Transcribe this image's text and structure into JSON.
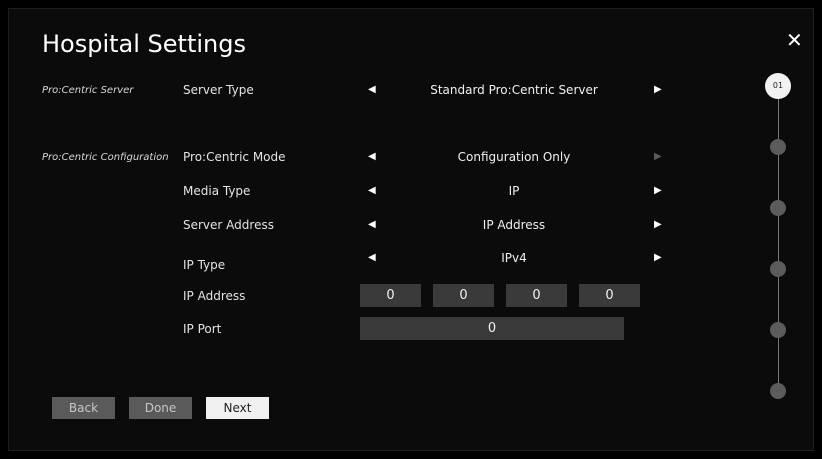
{
  "title": "Hospital Settings",
  "close_label": "✕",
  "sections": {
    "server": "Pro:Centric Server",
    "configuration": "Pro:Centric Configuration"
  },
  "rows": {
    "server_type": {
      "label": "Server Type",
      "value": "Standard Pro:Centric Server"
    },
    "mode": {
      "label": "Pro:Centric Mode",
      "value": "Configuration Only"
    },
    "media_type": {
      "label": "Media Type",
      "value": "IP"
    },
    "server_address": {
      "label": "Server Address",
      "value": "IP Address"
    },
    "ip_type": {
      "label": "IP Type",
      "value": "IPv4"
    },
    "ip_address": {
      "label": "IP Address",
      "octets": [
        "0",
        "0",
        "0",
        "0"
      ]
    },
    "ip_port": {
      "label": "IP Port",
      "value": "0"
    }
  },
  "arrows": {
    "left": "◀",
    "right": "▶"
  },
  "buttons": {
    "back": "Back",
    "done": "Done",
    "next": "Next"
  },
  "stepper": {
    "current": "01",
    "total_steps": 6
  }
}
